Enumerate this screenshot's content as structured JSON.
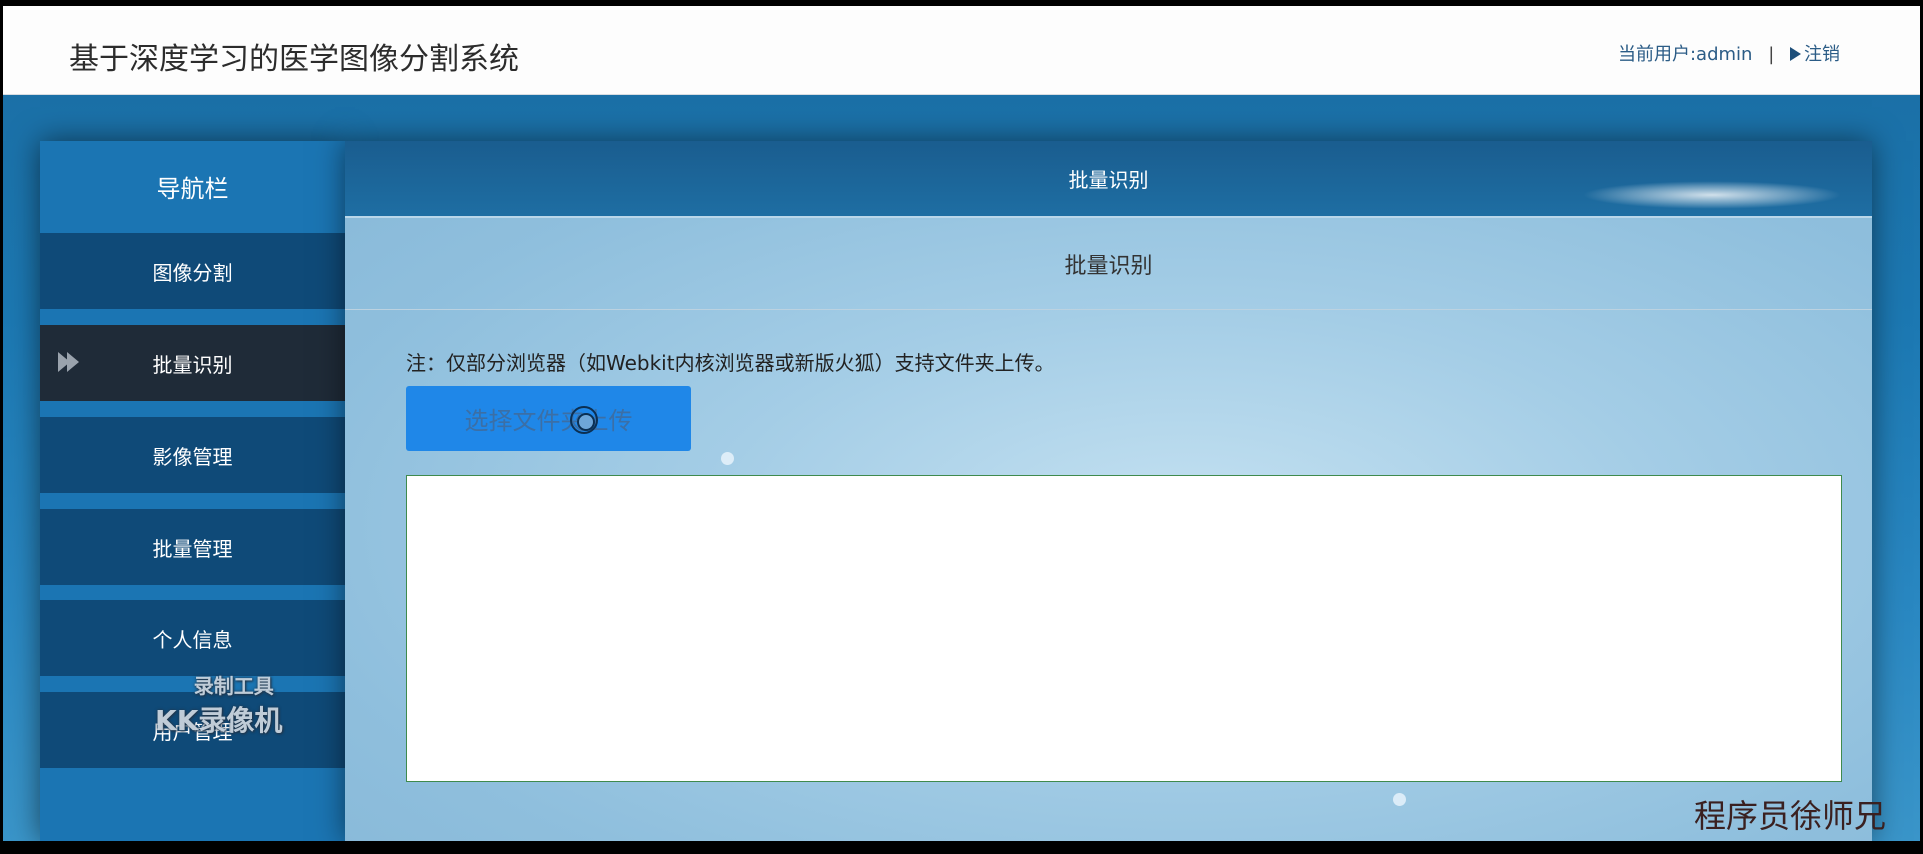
{
  "header": {
    "title": "基于深度学习的医学图像分割系统",
    "user_label": "当前用户:admin",
    "separator": "|",
    "logout_label": "注销"
  },
  "sidebar": {
    "title": "导航栏",
    "items": [
      {
        "label": "图像分割",
        "active": false
      },
      {
        "label": "批量识别",
        "active": true
      },
      {
        "label": "影像管理",
        "active": false
      },
      {
        "label": "批量管理",
        "active": false
      },
      {
        "label": "个人信息",
        "active": false
      },
      {
        "label": "用户管理",
        "active": false
      }
    ]
  },
  "main": {
    "header_title": "批量识别",
    "panel_title": "批量识别",
    "note": "注：仅部分浏览器（如Webkit内核浏览器或新版火狐）支持文件夹上传。",
    "upload_button_label": "选择文件夹上传",
    "result_text": ""
  },
  "watermark": {
    "line1": "录制工具",
    "line2": "KK录像机"
  },
  "signature": "程序员徐师兄",
  "colors": {
    "nav_item": "#0f4a78",
    "nav_active": "#1f2b38",
    "button": "#1f87e8",
    "result_border": "#3f8a4d"
  }
}
